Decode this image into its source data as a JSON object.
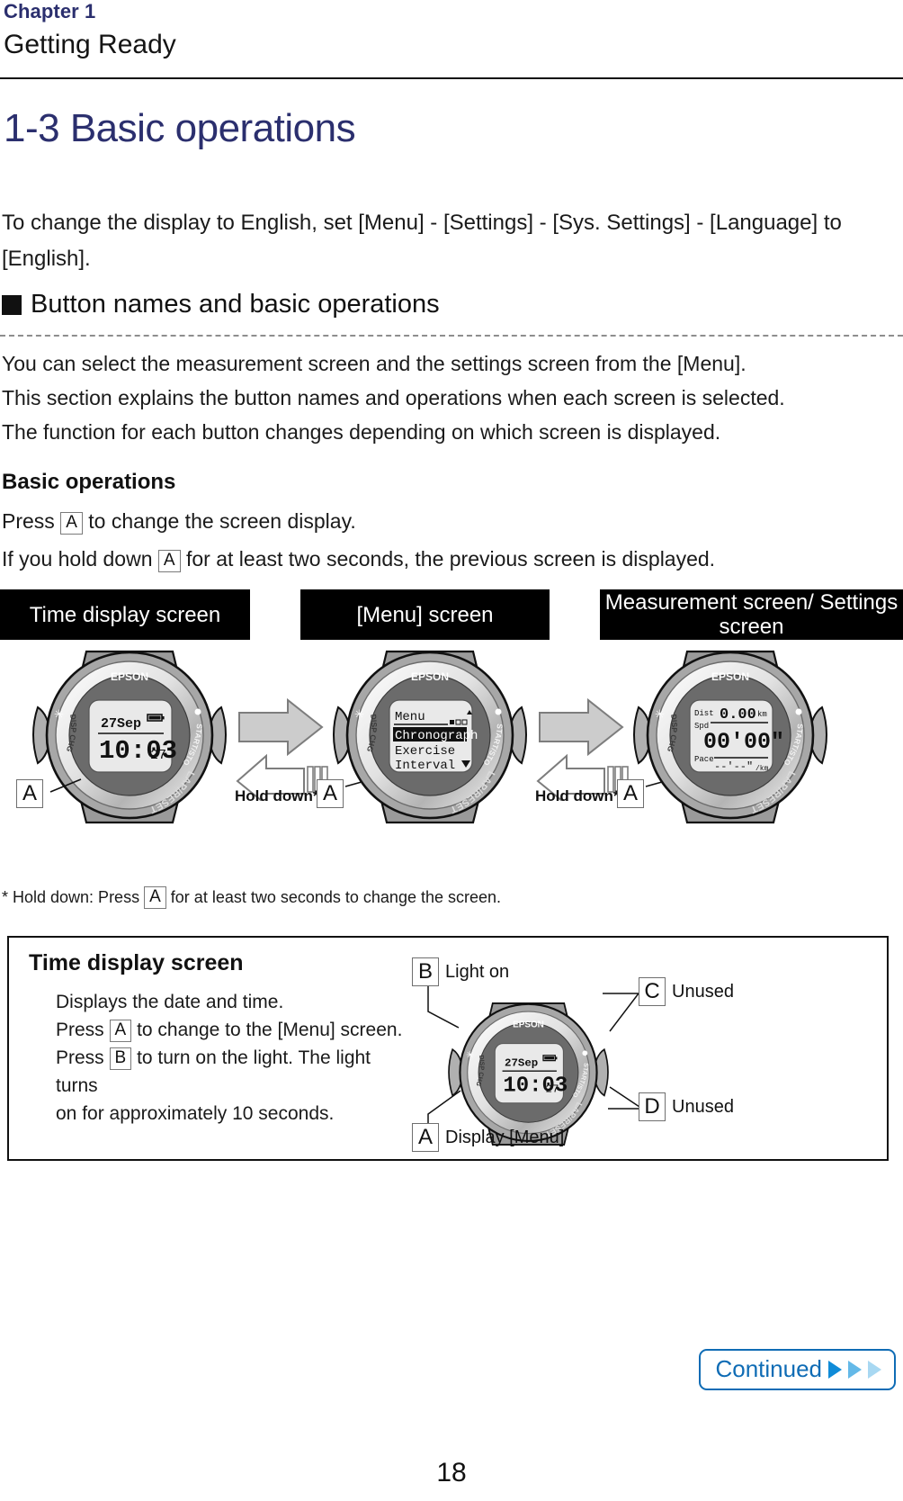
{
  "header": {
    "chapter": "Chapter 1",
    "chapter_title": "Getting Ready"
  },
  "section": {
    "title": "1-3 Basic operations",
    "intro": "To change the display to English, set [Menu] - [Settings] - [Sys. Settings] - [Language] to [English].",
    "sub_head": "Button names and basic operations",
    "para1": "You can select the measurement screen and the settings screen from the [Menu].",
    "para2": "This section explains the button names and operations when each screen is selected.",
    "para3": "The function for each button changes depending on which screen is displayed.",
    "basic_ops_head": "Basic operations",
    "press_line1_before": "Press",
    "press_line1_key": "A",
    "press_line1_after": "to change the screen display.",
    "press_line2_before": "If you hold down",
    "press_line2_key": "A",
    "press_line2_after": "for at least two seconds, the previous screen is displayed."
  },
  "flow": {
    "caption1": "Time display screen",
    "caption2": "[Menu] screen",
    "caption3": "Measurement screen/ Settings screen",
    "hold_down_label": "Hold down*",
    "key_a": "A",
    "footnote_before": "* Hold down: Press",
    "footnote_key": "A",
    "footnote_after": "for at least two seconds to change the screen."
  },
  "watch": {
    "brand": "EPSON",
    "bezel_start_stop": "START/STOP",
    "bezel_lap_reset": "LAP/RESET",
    "bezel_disp_chg": "DISP CHG",
    "time_screen": {
      "date": "27Sep",
      "time": "10:03",
      "seconds": "27",
      "battery_icon": "battery-icon"
    },
    "menu_screen": {
      "title": "Menu",
      "items": [
        "Chronograph",
        "Exercise",
        "Interval"
      ],
      "selected": "Chronograph",
      "page_dots": "■□□",
      "scroll_up": "▲",
      "scroll_down": "▼"
    },
    "measurement_screen": {
      "dist_label": "Dist",
      "dist_value": "0.00",
      "dist_unit": "km",
      "spd_label": "Spd",
      "spd_value": "00'00\"",
      "pace_label": "Pace",
      "pace_value": "--'--\"",
      "pace_unit": "/km"
    }
  },
  "panel": {
    "title": "Time display screen",
    "line1": "Displays the date and time.",
    "line2_before": "Press",
    "line2_key": "A",
    "line2_after": "to change to the [Menu] screen.",
    "line3_before": "Press",
    "line3_key": "B",
    "line3_after": "to turn on the light. The light turns",
    "line4": "on for approximately 10 seconds.",
    "callouts": [
      {
        "key": "B",
        "label": "Light on"
      },
      {
        "key": "C",
        "label": "Unused"
      },
      {
        "key": "D",
        "label": "Unused"
      },
      {
        "key": "A",
        "label": "Display [Menu]"
      }
    ]
  },
  "footer": {
    "page_number": "18",
    "continued_label": "Continued"
  },
  "colors": {
    "accent_navy": "#2b2f6e",
    "accent_blue": "#0f6cb5",
    "arrow_blue": "#0f8bd8",
    "caption_bg": "#000000"
  }
}
